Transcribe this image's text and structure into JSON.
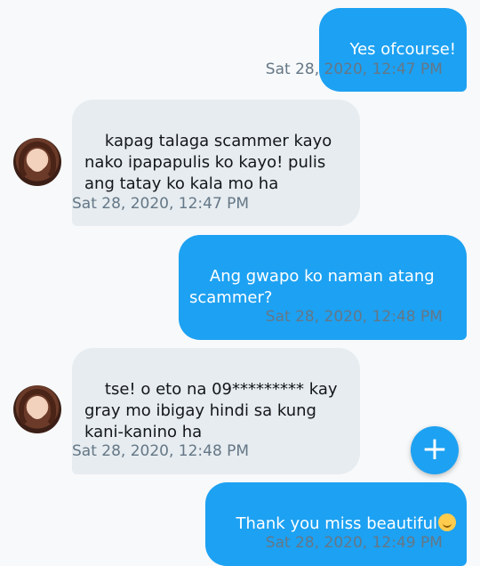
{
  "messages": [
    {
      "direction": "out",
      "text": "Yes ofcourse!",
      "timestamp": "Sat 28, 2020, 12:47 PM",
      "status": "sent"
    },
    {
      "direction": "in",
      "text": "kapag talaga scammer kayo nako ipapapulis ko kayo! pulis ang tatay ko kala mo ha",
      "timestamp": "Sat 28, 2020, 12:47 PM"
    },
    {
      "direction": "out",
      "text": "Ang gwapo ko naman atang scammer?",
      "timestamp": "Sat 28, 2020, 12:48 PM",
      "status": "sent"
    },
    {
      "direction": "in",
      "text": "tse! o eto na 09********* kay gray mo ibigay hindi sa kung kani-kanino ha",
      "timestamp": "Sat 28, 2020, 12:48 PM"
    },
    {
      "direction": "out",
      "text": "Thank you miss beautiful",
      "emoji": "smiling-face-emoji",
      "timestamp": "Sat 28, 2020, 12:49 PM",
      "status": "sent"
    }
  ],
  "icons": {
    "sent_check": "✓",
    "fab": "+"
  },
  "colors": {
    "accent": "#1da1f2",
    "incoming_bubble": "#e6ecf0",
    "timestamp": "#657786",
    "background": "#f7f9fa"
  }
}
